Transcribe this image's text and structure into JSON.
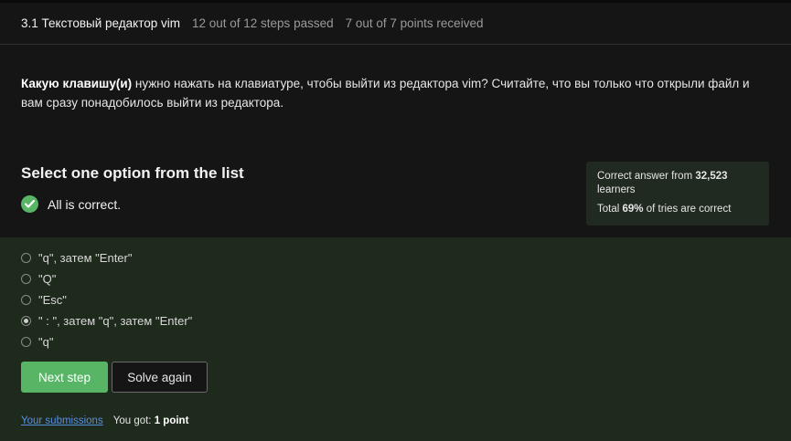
{
  "header": {
    "lesson_title": "3.1 Текстовый редактор vim",
    "steps_status": "12 out of 12 steps passed",
    "points_status": "7 out of 7 points  received"
  },
  "question": {
    "bold_part": "Какую клавишу(и)",
    "rest": " нужно нажать на клавиатуре, чтобы выйти из редактора vim? Считайте, что вы только что открыли файл и вам сразу понадобилось выйти из редактора."
  },
  "task": {
    "title": "Select one option from the list",
    "feedback": "All is correct."
  },
  "stats": {
    "line1_prefix": "Correct answer from ",
    "learners_count": "32,523",
    "line1_suffix": " learners",
    "line2_prefix": "Total ",
    "percent": "69%",
    "line2_suffix": " of tries are correct"
  },
  "options": [
    {
      "label": "\"q\", затем \"Enter\"",
      "selected": false
    },
    {
      "label": "\"Q\"",
      "selected": false
    },
    {
      "label": "\"Esc\"",
      "selected": false
    },
    {
      "label": "\" : \", затем \"q\", затем \"Enter\"",
      "selected": true
    },
    {
      "label": "\"q\"",
      "selected": false
    }
  ],
  "actions": {
    "next_label": "Next step",
    "solve_again_label": "Solve again"
  },
  "footer": {
    "submissions_link": "Your submissions",
    "got_prefix": "You got: ",
    "got_value": "1 point"
  },
  "colors": {
    "accent_green": "#59b566",
    "answers_bg": "#1e2a1c",
    "link_blue": "#5a8fe0"
  },
  "icons": {
    "feedback": "check-circle-icon"
  }
}
